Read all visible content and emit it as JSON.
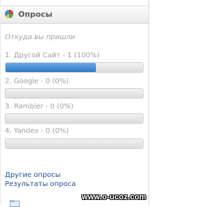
{
  "poll": {
    "title": "Опросы",
    "question": "Откуда вы пришли",
    "answers": [
      {
        "label": "1. Другой Сайт - 1 (100%)",
        "percent": 100,
        "bar_fill_fraction": 0.66
      },
      {
        "label": "2. Google - 0 (0%)",
        "percent": 0,
        "bar_fill_fraction": 0
      },
      {
        "label": "3. Rambler - 0 (0%)",
        "percent": 0,
        "bar_fill_fraction": 0
      },
      {
        "label": "4. Yandex - 0 (0%)",
        "percent": 0,
        "bar_fill_fraction": 0
      }
    ],
    "links": {
      "other_polls": "Другие опросы",
      "results": "Результаты опроса"
    }
  },
  "watermark": "www.o-ucoz.com",
  "icons": {
    "header": "pie-chart-icon",
    "bottom": "folder-icon"
  },
  "colors": {
    "bar_fill": "#3b82d0",
    "link": "#1f4f9a",
    "muted_text": "#a0a0a0"
  }
}
